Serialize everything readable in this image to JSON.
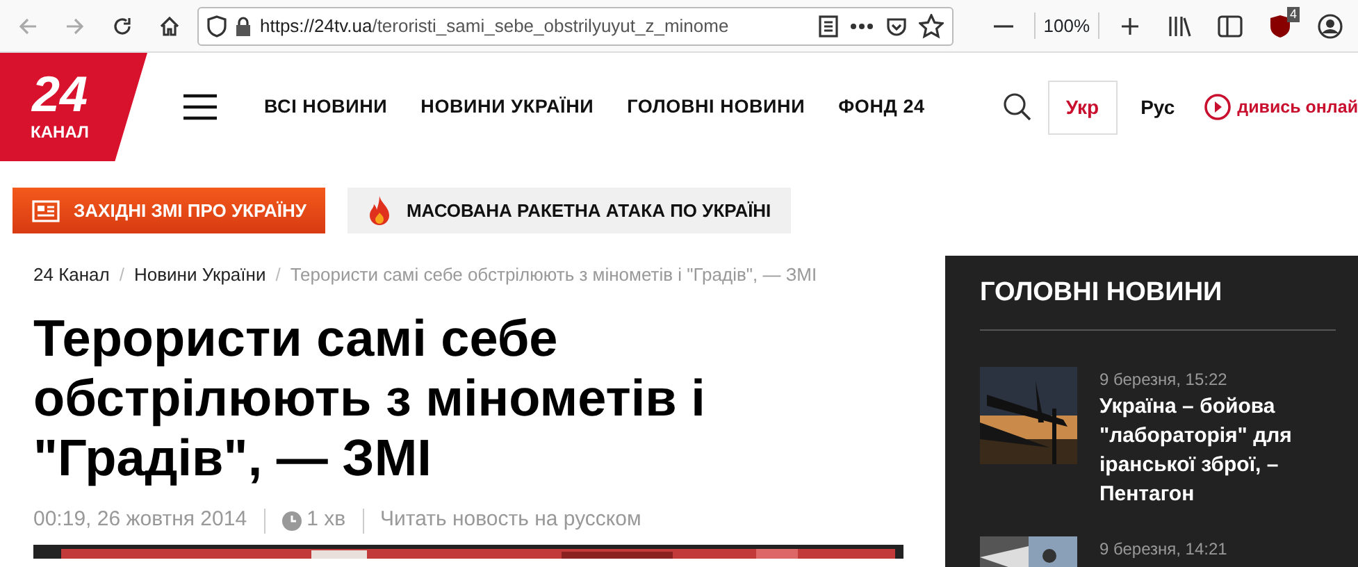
{
  "browser": {
    "url_host": "https://24tv.ua",
    "url_path": "/teroristi_sami_sebe_obstrilyuyut_z_minome",
    "zoom": "100%",
    "extension_badge": "4"
  },
  "logo": {
    "number": "24",
    "caption": "КАНАЛ"
  },
  "nav": [
    "ВСІ НОВИНИ",
    "НОВИНИ УКРАЇНИ",
    "ГОЛОВНІ НОВИНИ",
    "ФОНД 24"
  ],
  "languages": [
    {
      "label": "Укр",
      "selected": true
    },
    {
      "label": "Рус",
      "selected": false
    }
  ],
  "watch_link": "дивись онлай",
  "promo_buttons": [
    {
      "kind": "primary",
      "label": "ЗАХІДНІ ЗМІ ПРО УКРАЇНУ"
    },
    {
      "kind": "secondary",
      "label": "МАСОВАНА РАКЕТНА АТАКА ПО УКРАЇНІ"
    }
  ],
  "breadcrumbs": [
    {
      "label": "24 Канал",
      "current": false
    },
    {
      "separator": "/",
      "label": "Новини України",
      "current": false
    },
    {
      "separator": "/",
      "label": "Терористи самі себе обстрілюють з мінометів і \"Градів\", — ЗМІ",
      "current": true
    }
  ],
  "article": {
    "title": "Терористи самі себе обстрілюють з мінометів і \"Градів\", — ЗМІ",
    "date": "00:19, 26 жовтня 2014",
    "read_time": "1 хв",
    "translation_link": "Читать новость на русском"
  },
  "sidebar": {
    "heading": "ГОЛОВНІ НОВИНИ",
    "items": [
      {
        "time": "9 березня, 15:22",
        "title": "Україна – бойова \"лабораторія\" для іранської зброї, – Пентагон"
      },
      {
        "time": "9 березня, 14:21"
      }
    ]
  }
}
